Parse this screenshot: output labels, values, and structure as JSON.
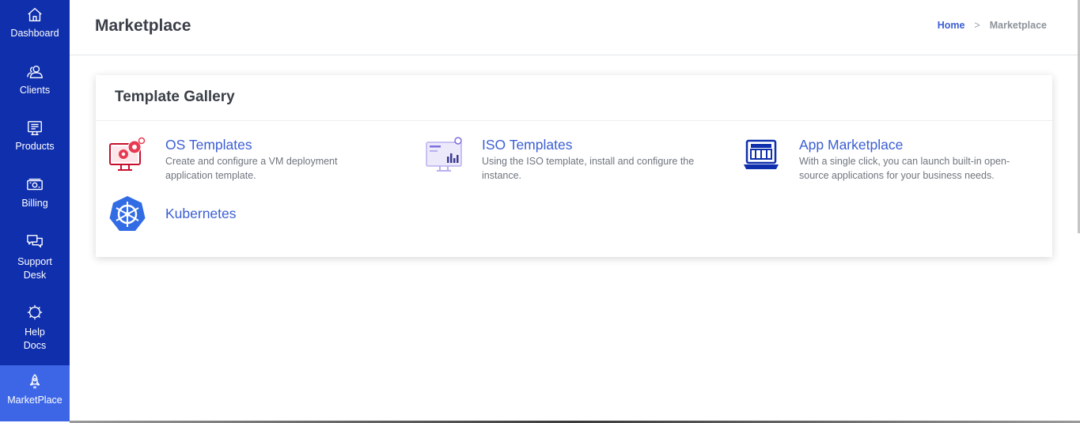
{
  "sidebar": {
    "items": [
      {
        "label": "Dashboard",
        "icon": "home-icon"
      },
      {
        "label": "Clients",
        "icon": "users-icon"
      },
      {
        "label": "Products",
        "icon": "products-icon"
      },
      {
        "label": "Billing",
        "icon": "billing-icon"
      },
      {
        "label": "Support\nDesk",
        "label_line1": "Support",
        "label_line2": "Desk",
        "icon": "chat-icon"
      },
      {
        "label_line1": "Help",
        "label_line2": "Docs",
        "icon": "gear-icon"
      },
      {
        "label": "MarketPlace",
        "icon": "rocket-icon",
        "active": true
      }
    ]
  },
  "header": {
    "title": "Marketplace",
    "breadcrumb": {
      "home": "Home",
      "separator": ">",
      "current": "Marketplace"
    }
  },
  "gallery": {
    "title": "Template Gallery",
    "tiles": [
      {
        "title": "OS Templates",
        "description": "Create and configure a VM deployment application template.",
        "icon": "os-template-icon"
      },
      {
        "title": "ISO Templates",
        "description": "Using the ISO template, install and configure the instance.",
        "icon": "iso-template-icon"
      },
      {
        "title": "App Marketplace",
        "description": "With a single click, you can launch built-in open-source applications for your business needs.",
        "icon": "app-marketplace-icon"
      },
      {
        "title": "Kubernetes",
        "description": "",
        "icon": "kubernetes-icon"
      }
    ]
  },
  "colors": {
    "sidebar_bg": "#0f2fad",
    "sidebar_active": "#3d66e6",
    "accent": "#3b5ed4"
  }
}
